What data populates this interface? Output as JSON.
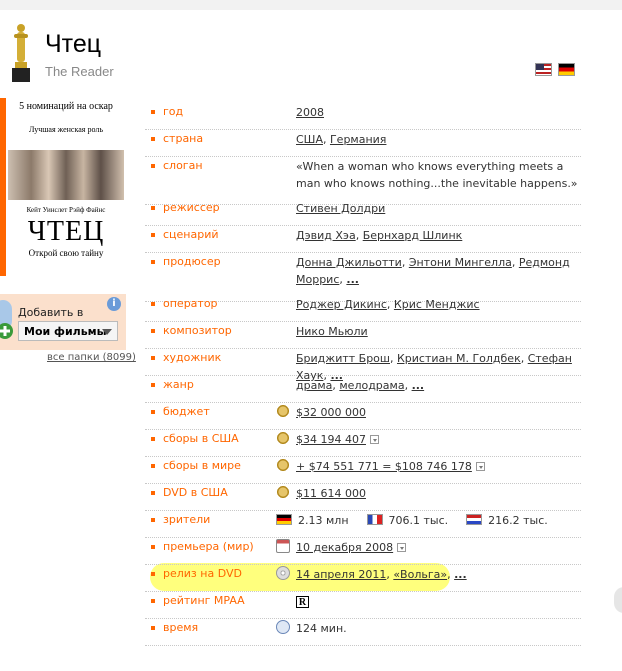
{
  "header": {
    "title": "Чтец",
    "original_title": "The Reader",
    "flags": [
      "us-flag-icon",
      "de-flag-icon"
    ]
  },
  "poster": {
    "nominations": "5 номинаций на оскар",
    "role": "Лучшая женская роль",
    "actors": "Кейт Уинслет   Рэйф Файнс",
    "title": "ЧТЕЦ",
    "tagline": "Открой свою тайну"
  },
  "folders": {
    "add_label": "Добавить в",
    "selected": "Мои фильмы",
    "all_folders": "все папки (8099)"
  },
  "rows": [
    {
      "label": "год",
      "segments": [
        {
          "t": "2008",
          "link": true
        }
      ]
    },
    {
      "label": "страна",
      "segments": [
        {
          "t": "США",
          "link": true
        },
        {
          "t": ", "
        },
        {
          "t": "Германия",
          "link": true
        }
      ]
    },
    {
      "label": "слоган",
      "segments": [
        {
          "t": "«When a woman who knows everything meets a man who knows nothing...the inevitable happens.»"
        }
      ]
    },
    {
      "label": "режиссер",
      "segments": [
        {
          "t": "Стивен Долдри",
          "link": true
        }
      ]
    },
    {
      "label": "сценарий",
      "segments": [
        {
          "t": "Дэвид Хэа",
          "link": true
        },
        {
          "t": ", "
        },
        {
          "t": "Бернхард Шлинк",
          "link": true
        }
      ]
    },
    {
      "label": "продюсер",
      "segments": [
        {
          "t": "Донна Джильотти",
          "link": true
        },
        {
          "t": ", "
        },
        {
          "t": "Энтони Мингелла",
          "link": true
        },
        {
          "t": ", "
        },
        {
          "t": "Редмонд Моррис",
          "link": true
        },
        {
          "t": ", "
        },
        {
          "t": "...",
          "more": true
        }
      ]
    },
    {
      "label": "оператор",
      "segments": [
        {
          "t": "Роджер Дикинс",
          "link": true
        },
        {
          "t": ", "
        },
        {
          "t": "Крис Менджис",
          "link": true
        }
      ]
    },
    {
      "label": "композитор",
      "segments": [
        {
          "t": "Нико Мьюли",
          "link": true
        }
      ]
    },
    {
      "label": "художник",
      "segments": [
        {
          "t": "Бриджитт Брош",
          "link": true
        },
        {
          "t": ", "
        },
        {
          "t": "Кристиан М. Голдбек",
          "link": true
        },
        {
          "t": ", "
        },
        {
          "t": "Стефан Хаук",
          "link": true
        },
        {
          "t": ", "
        },
        {
          "t": "...",
          "more": true
        }
      ]
    },
    {
      "label": "жанр",
      "segments": [
        {
          "t": "драма",
          "link": true
        },
        {
          "t": ", "
        },
        {
          "t": "мелодрама",
          "link": true
        },
        {
          "t": ", "
        },
        {
          "t": "...",
          "more": true
        }
      ]
    },
    {
      "label": "бюджет",
      "icon": "coin",
      "segments": [
        {
          "t": "$32 000 000",
          "link": true
        }
      ]
    },
    {
      "label": "сборы в США",
      "icon": "coin",
      "segments": [
        {
          "t": "$34 194 407",
          "link": true
        }
      ],
      "dropdown": true
    },
    {
      "label": "сборы в мире",
      "icon": "coin",
      "segments": [
        {
          "t": "+ $74 551 771 = $108 746 178",
          "link": true
        }
      ],
      "dropdown": true
    },
    {
      "label": "DVD в США",
      "icon": "coin",
      "segments": [
        {
          "t": "$11 614 000",
          "link": true
        }
      ]
    },
    {
      "label": "зрители",
      "audience": [
        {
          "flag": "de",
          "t": "2.13 млн"
        },
        {
          "flag": "fr",
          "t": "706.1 тыс."
        },
        {
          "flag": "nl",
          "t": "216.2 тыс."
        }
      ]
    },
    {
      "label": "премьера (мир)",
      "icon": "calendar",
      "segments": [
        {
          "t": "10 декабря 2008",
          "link": true
        }
      ],
      "dropdown": true
    },
    {
      "label": "релиз на DVD",
      "icon": "disc",
      "segments": [
        {
          "t": "14 апреля 2011",
          "link": true
        },
        {
          "t": ", "
        },
        {
          "t": "«Вольга»",
          "link": true
        },
        {
          "t": ", "
        },
        {
          "t": "...",
          "more": true
        }
      ]
    },
    {
      "label": "рейтинг MPAA",
      "mpaa": "R"
    },
    {
      "label": "время",
      "icon": "clock",
      "segments": [
        {
          "t": "124 мин."
        }
      ]
    }
  ],
  "colors": {
    "accent": "#ff6600",
    "highlight": "#ffff66"
  }
}
